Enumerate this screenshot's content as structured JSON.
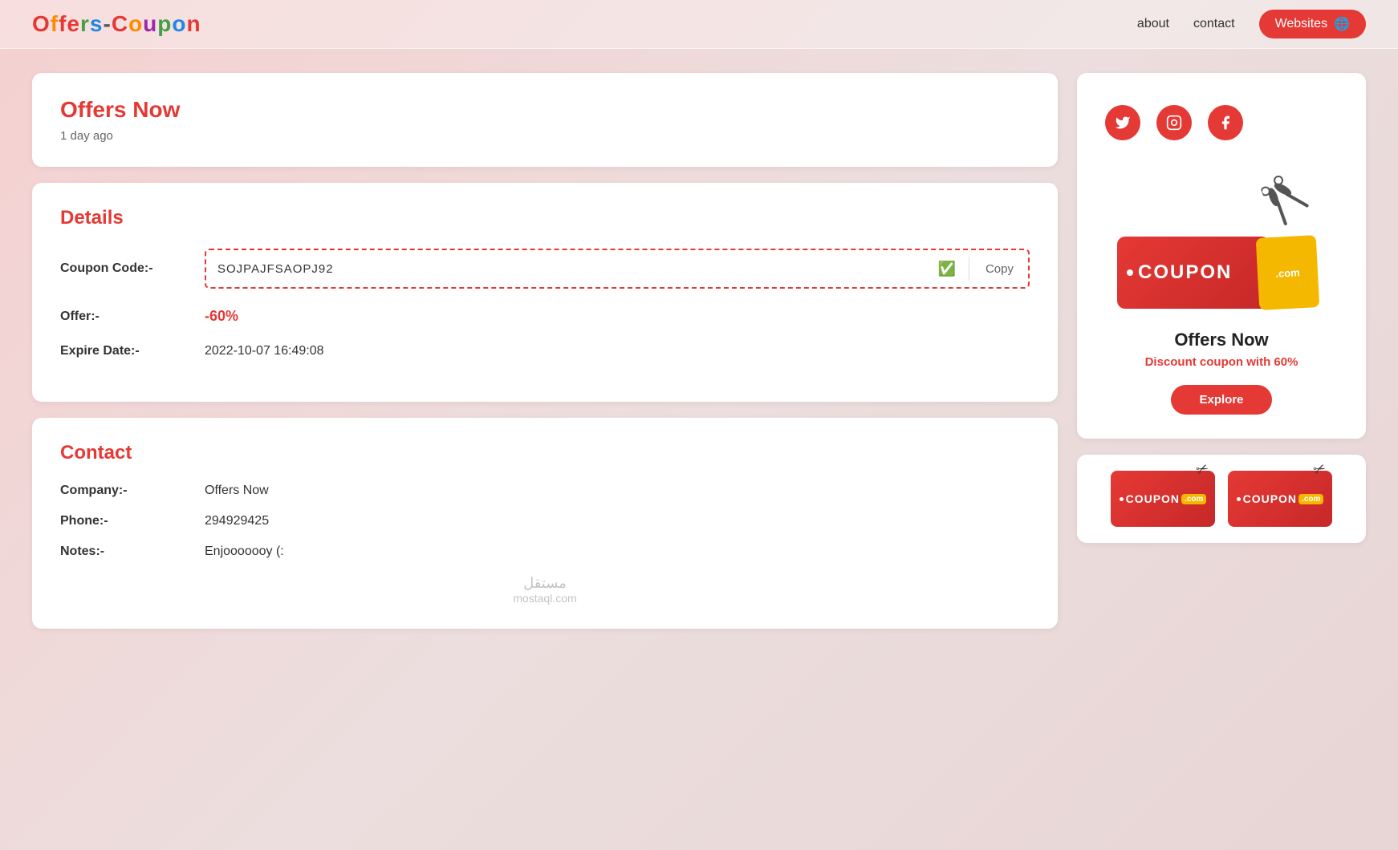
{
  "header": {
    "logo": {
      "text": "Offers-Coupon",
      "part1": "Offers",
      "dash": "-",
      "part2": "Coupon"
    },
    "nav": {
      "about_label": "about",
      "contact_label": "contact",
      "websites_label": "Websites",
      "websites_icon": "🌐"
    }
  },
  "main": {
    "offers_card": {
      "title": "Offers Now",
      "time_ago": "1 day ago"
    },
    "details_card": {
      "title": "Details",
      "coupon_code_label": "Coupon Code:-",
      "coupon_code_value": "SOJPAJFSAOPJ92",
      "copy_label": "Copy",
      "offer_label": "Offer:-",
      "offer_value": "-60%",
      "expire_label": "Expire Date:-",
      "expire_value": "2022-10-07 16:49:08"
    },
    "contact_card": {
      "title": "Contact",
      "company_label": "Company:-",
      "company_value": "Offers Now",
      "phone_label": "Phone:-",
      "phone_value": "294929425",
      "notes_label": "Notes:-",
      "notes_value": "Enjooooooy (:"
    },
    "watermark": {
      "line1": "مستقل",
      "line2": "mostaql.com"
    }
  },
  "sidebar": {
    "social": {
      "twitter_label": "Twitter",
      "instagram_label": "Instagram",
      "facebook_label": "Facebook"
    },
    "coupon_promo": {
      "logo_text": "COUPON",
      "dot_com": ".com",
      "title": "Offers Now",
      "subtitle": "Discount coupon with 60%",
      "explore_label": "Explore"
    }
  }
}
